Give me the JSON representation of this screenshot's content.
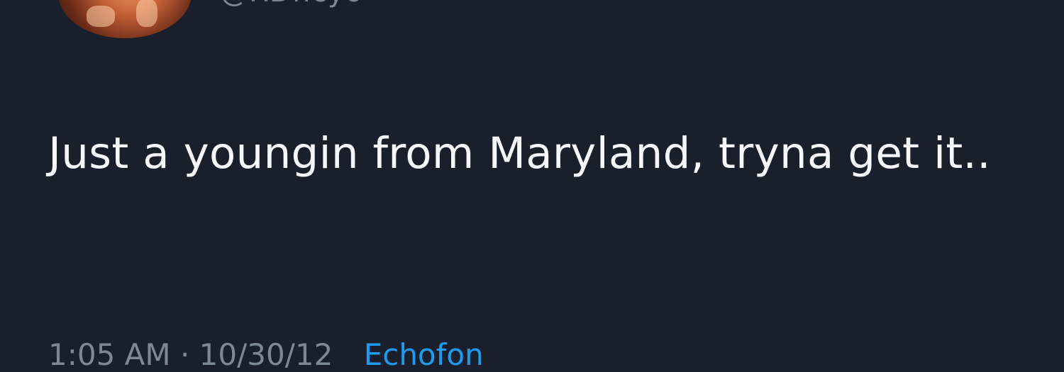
{
  "tweet": {
    "handle": "@RDficyo",
    "text": "Just a youngin from Maryland, tryna get it..",
    "timestamp": "1:05 AM · 10/30/12",
    "source": "Echofon"
  },
  "colors": {
    "background": "#1a202b",
    "text": "#f5f7fa",
    "muted": "#7d8894",
    "link": "#1d9bf0"
  }
}
